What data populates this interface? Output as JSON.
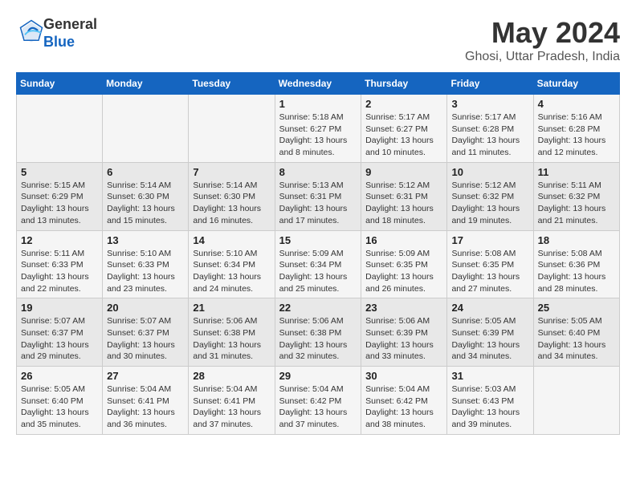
{
  "logo": {
    "general": "General",
    "blue": "Blue"
  },
  "title": "May 2024",
  "location": "Ghosi, Uttar Pradesh, India",
  "days_of_week": [
    "Sunday",
    "Monday",
    "Tuesday",
    "Wednesday",
    "Thursday",
    "Friday",
    "Saturday"
  ],
  "weeks": [
    [
      {
        "day": "",
        "info": ""
      },
      {
        "day": "",
        "info": ""
      },
      {
        "day": "",
        "info": ""
      },
      {
        "day": "1",
        "info": "Sunrise: 5:18 AM\nSunset: 6:27 PM\nDaylight: 13 hours\nand 8 minutes."
      },
      {
        "day": "2",
        "info": "Sunrise: 5:17 AM\nSunset: 6:27 PM\nDaylight: 13 hours\nand 10 minutes."
      },
      {
        "day": "3",
        "info": "Sunrise: 5:17 AM\nSunset: 6:28 PM\nDaylight: 13 hours\nand 11 minutes."
      },
      {
        "day": "4",
        "info": "Sunrise: 5:16 AM\nSunset: 6:28 PM\nDaylight: 13 hours\nand 12 minutes."
      }
    ],
    [
      {
        "day": "5",
        "info": "Sunrise: 5:15 AM\nSunset: 6:29 PM\nDaylight: 13 hours\nand 13 minutes."
      },
      {
        "day": "6",
        "info": "Sunrise: 5:14 AM\nSunset: 6:30 PM\nDaylight: 13 hours\nand 15 minutes."
      },
      {
        "day": "7",
        "info": "Sunrise: 5:14 AM\nSunset: 6:30 PM\nDaylight: 13 hours\nand 16 minutes."
      },
      {
        "day": "8",
        "info": "Sunrise: 5:13 AM\nSunset: 6:31 PM\nDaylight: 13 hours\nand 17 minutes."
      },
      {
        "day": "9",
        "info": "Sunrise: 5:12 AM\nSunset: 6:31 PM\nDaylight: 13 hours\nand 18 minutes."
      },
      {
        "day": "10",
        "info": "Sunrise: 5:12 AM\nSunset: 6:32 PM\nDaylight: 13 hours\nand 19 minutes."
      },
      {
        "day": "11",
        "info": "Sunrise: 5:11 AM\nSunset: 6:32 PM\nDaylight: 13 hours\nand 21 minutes."
      }
    ],
    [
      {
        "day": "12",
        "info": "Sunrise: 5:11 AM\nSunset: 6:33 PM\nDaylight: 13 hours\nand 22 minutes."
      },
      {
        "day": "13",
        "info": "Sunrise: 5:10 AM\nSunset: 6:33 PM\nDaylight: 13 hours\nand 23 minutes."
      },
      {
        "day": "14",
        "info": "Sunrise: 5:10 AM\nSunset: 6:34 PM\nDaylight: 13 hours\nand 24 minutes."
      },
      {
        "day": "15",
        "info": "Sunrise: 5:09 AM\nSunset: 6:34 PM\nDaylight: 13 hours\nand 25 minutes."
      },
      {
        "day": "16",
        "info": "Sunrise: 5:09 AM\nSunset: 6:35 PM\nDaylight: 13 hours\nand 26 minutes."
      },
      {
        "day": "17",
        "info": "Sunrise: 5:08 AM\nSunset: 6:35 PM\nDaylight: 13 hours\nand 27 minutes."
      },
      {
        "day": "18",
        "info": "Sunrise: 5:08 AM\nSunset: 6:36 PM\nDaylight: 13 hours\nand 28 minutes."
      }
    ],
    [
      {
        "day": "19",
        "info": "Sunrise: 5:07 AM\nSunset: 6:37 PM\nDaylight: 13 hours\nand 29 minutes."
      },
      {
        "day": "20",
        "info": "Sunrise: 5:07 AM\nSunset: 6:37 PM\nDaylight: 13 hours\nand 30 minutes."
      },
      {
        "day": "21",
        "info": "Sunrise: 5:06 AM\nSunset: 6:38 PM\nDaylight: 13 hours\nand 31 minutes."
      },
      {
        "day": "22",
        "info": "Sunrise: 5:06 AM\nSunset: 6:38 PM\nDaylight: 13 hours\nand 32 minutes."
      },
      {
        "day": "23",
        "info": "Sunrise: 5:06 AM\nSunset: 6:39 PM\nDaylight: 13 hours\nand 33 minutes."
      },
      {
        "day": "24",
        "info": "Sunrise: 5:05 AM\nSunset: 6:39 PM\nDaylight: 13 hours\nand 34 minutes."
      },
      {
        "day": "25",
        "info": "Sunrise: 5:05 AM\nSunset: 6:40 PM\nDaylight: 13 hours\nand 34 minutes."
      }
    ],
    [
      {
        "day": "26",
        "info": "Sunrise: 5:05 AM\nSunset: 6:40 PM\nDaylight: 13 hours\nand 35 minutes."
      },
      {
        "day": "27",
        "info": "Sunrise: 5:04 AM\nSunset: 6:41 PM\nDaylight: 13 hours\nand 36 minutes."
      },
      {
        "day": "28",
        "info": "Sunrise: 5:04 AM\nSunset: 6:41 PM\nDaylight: 13 hours\nand 37 minutes."
      },
      {
        "day": "29",
        "info": "Sunrise: 5:04 AM\nSunset: 6:42 PM\nDaylight: 13 hours\nand 37 minutes."
      },
      {
        "day": "30",
        "info": "Sunrise: 5:04 AM\nSunset: 6:42 PM\nDaylight: 13 hours\nand 38 minutes."
      },
      {
        "day": "31",
        "info": "Sunrise: 5:03 AM\nSunset: 6:43 PM\nDaylight: 13 hours\nand 39 minutes."
      },
      {
        "day": "",
        "info": ""
      }
    ]
  ]
}
